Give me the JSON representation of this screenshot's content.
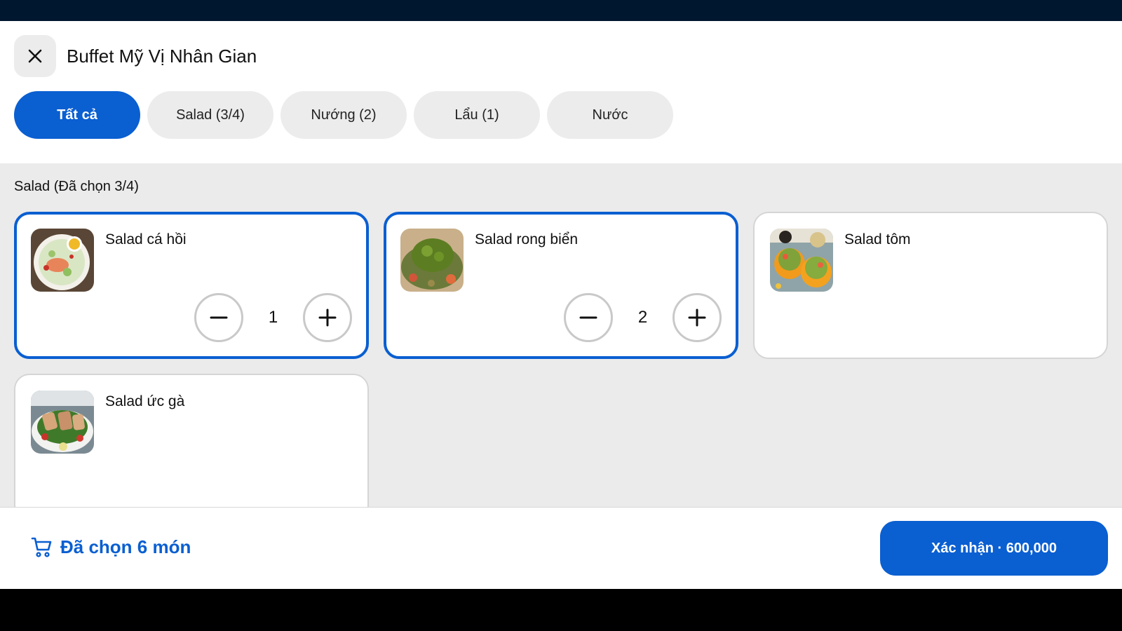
{
  "header": {
    "title": "Buffet Mỹ Vị Nhân Gian",
    "close_icon": "close-icon"
  },
  "tabs": [
    {
      "label": "Tất cả",
      "active": true
    },
    {
      "label": "Salad (3/4)",
      "active": false
    },
    {
      "label": "Nướng (2)",
      "active": false
    },
    {
      "label": "Lẩu (1)",
      "active": false
    },
    {
      "label": "Nước",
      "active": false
    }
  ],
  "section": {
    "title": "Salad (Đã chọn 3/4)"
  },
  "items": [
    {
      "name": "Salad cá hồi",
      "qty": "1",
      "selected": true
    },
    {
      "name": "Salad rong biển",
      "qty": "2",
      "selected": true
    },
    {
      "name": "Salad tôm",
      "selected": false
    },
    {
      "name": "Salad ức gà",
      "selected": false
    }
  ],
  "footer": {
    "cart_icon": "cart-icon",
    "selected_text": "Đã chọn 6 món",
    "confirm_label": "Xác nhận · 600,000"
  },
  "colors": {
    "accent": "#0a5fd1",
    "status_bar": "#001730",
    "background": "#ebebeb"
  }
}
